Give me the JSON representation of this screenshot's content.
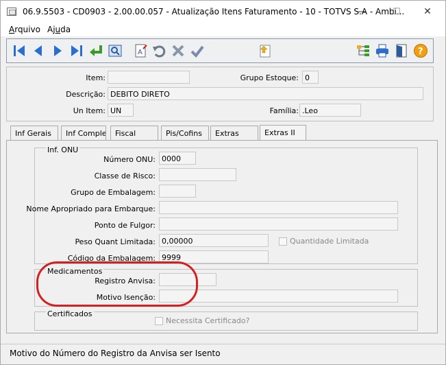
{
  "window": {
    "title": "06.9.5503 - CD0903 - 2.00.00.057 - Atualização Itens Faturamento - 10 - TOTVS S.A - Ambi...",
    "minimize": "—",
    "maximize": "☐",
    "close": "✕"
  },
  "menu": {
    "arquivo_prefix": "A",
    "arquivo_rest": "rquivo",
    "ajuda_prefix": "Aj",
    "ajuda_u": "u",
    "ajuda_rest": "da"
  },
  "header": {
    "item_label": "Item:",
    "item_value": "",
    "grupo_estoque_label": "Grupo Estoque:",
    "grupo_estoque_value": "0",
    "descricao_label": "Descrição:",
    "descricao_value": "DEBITO DIRETO",
    "un_item_label": "Un Item:",
    "un_item_value": "UN",
    "familia_label": "Família:",
    "familia_value": ".Leo"
  },
  "tabs": [
    {
      "label": "Inf Gerais"
    },
    {
      "label": "Inf Complem"
    },
    {
      "label": "Fiscal"
    },
    {
      "label": "Pis/Cofins"
    },
    {
      "label": "Extras"
    },
    {
      "label": "Extras II"
    }
  ],
  "inf_onu": {
    "group_title": "Inf. ONU",
    "numero_onu_label": "Número ONU:",
    "numero_onu_value": "0000",
    "classe_risco_label": "Classe de Risco:",
    "classe_risco_value": "",
    "grupo_embalagem_label": "Grupo de Embalagem:",
    "grupo_embalagem_value": "",
    "nome_apropriado_label": "Nome Apropriado para Embarque:",
    "nome_apropriado_value": "",
    "ponto_fulgor_label": "Ponto de Fulgor:",
    "ponto_fulgor_value": "",
    "peso_quant_label": "Peso Quant Limitada:",
    "peso_quant_value": "0,00000",
    "quantidade_limitada_label": "Quantidade Limitada",
    "codigo_embalagem_label": "Código da Embalagem:",
    "codigo_embalagem_value": "9999"
  },
  "medicamentos": {
    "group_title": "Medicamentos",
    "registro_anvisa_label": "Registro Anvisa:",
    "registro_anvisa_value": "",
    "motivo_isencao_label": "Motivo Isenção:",
    "motivo_isencao_value": ""
  },
  "certificados": {
    "group_title": "Certificados",
    "necessita_label": "Necessita Certificado?"
  },
  "status": {
    "text": "Motivo do Número do Registro da Anvisa ser Isento"
  },
  "colors": {
    "annotation": "#d42020",
    "toolbar_blue": "#2a6fd0",
    "toolbar_green": "#3a9a2a"
  }
}
